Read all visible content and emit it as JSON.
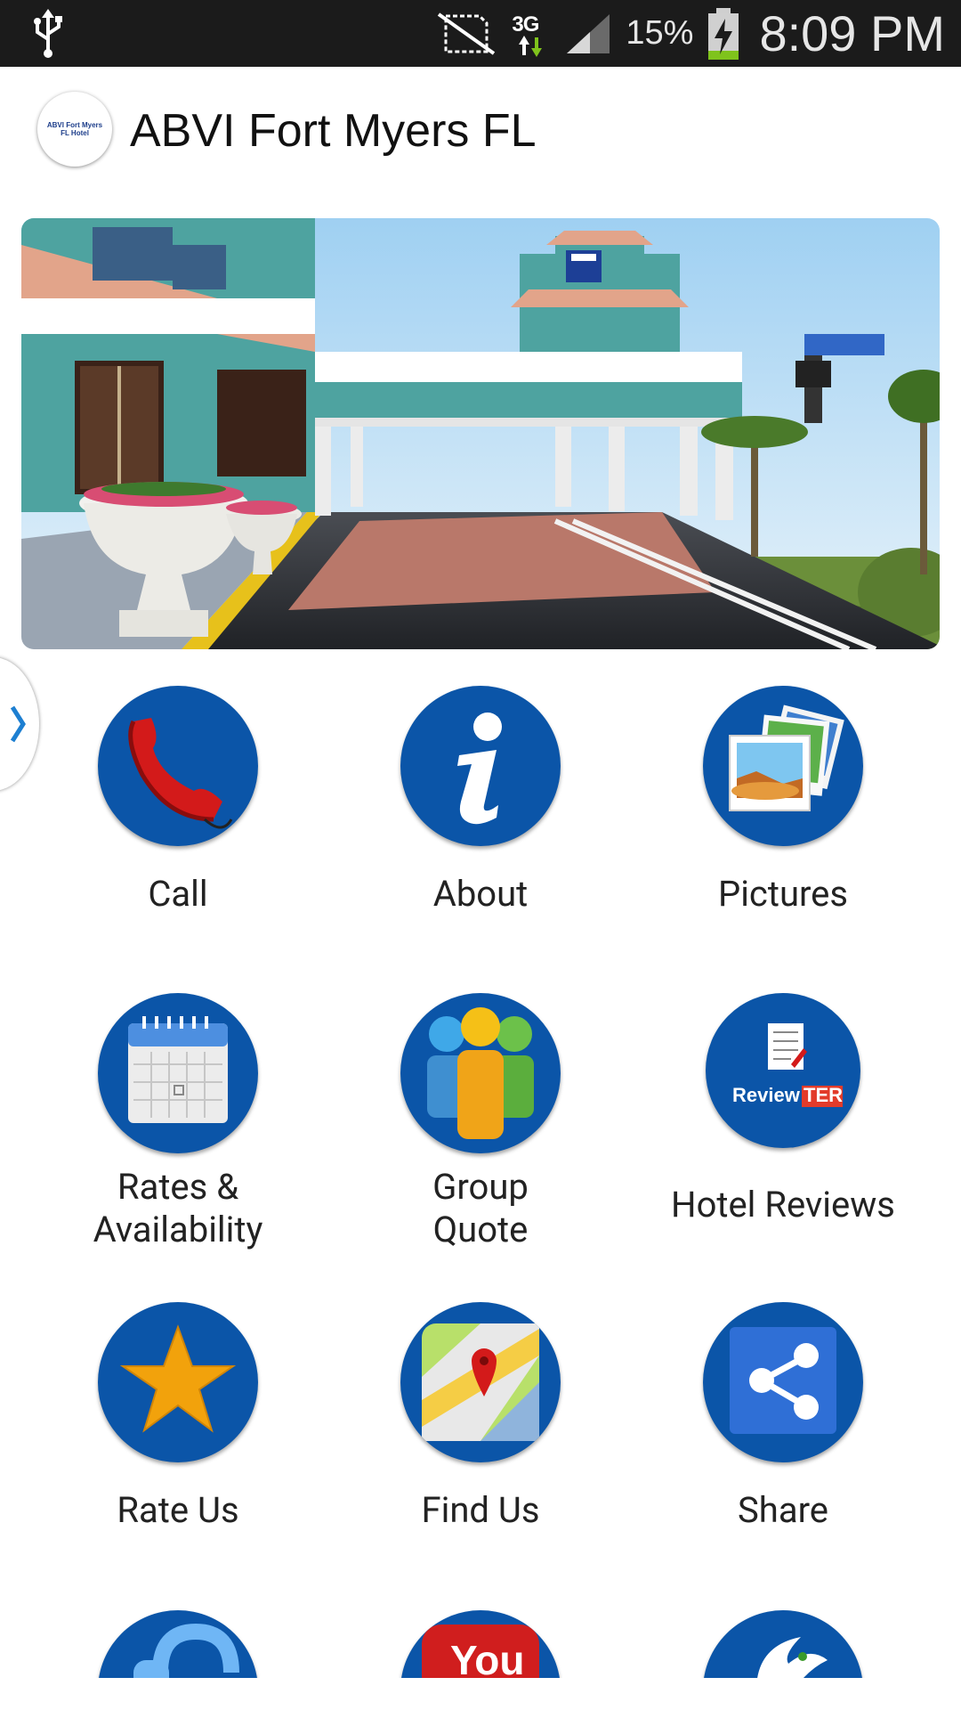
{
  "status_bar": {
    "network": "3G",
    "battery_percent": "15%",
    "time": "8:09 PM"
  },
  "header": {
    "logo_text": "ABVI Fort Myers FL Hotel",
    "title": "ABVI Fort Myers FL"
  },
  "grid": [
    {
      "label": "Call",
      "icon": "phone-icon"
    },
    {
      "label": "About",
      "icon": "info-icon"
    },
    {
      "label": "Pictures",
      "icon": "photos-icon"
    },
    {
      "label_line1": "Rates &",
      "label_line2": "Availability",
      "icon": "calendar-icon"
    },
    {
      "label_line1": "Group",
      "label_line2": "Quote",
      "icon": "group-icon"
    },
    {
      "label": "Hotel Reviews",
      "icon": "reviewter-icon",
      "icon_text": "ReviewTER"
    },
    {
      "label": "Rate Us",
      "icon": "star-icon"
    },
    {
      "label": "Find Us",
      "icon": "map-pin-icon"
    },
    {
      "label": "Share",
      "icon": "share-icon"
    },
    {
      "icon": "headset-icon"
    },
    {
      "icon": "youtube-icon",
      "icon_text": "You"
    },
    {
      "icon": "bird-icon"
    }
  ],
  "colors": {
    "icon_blue": "#0b55a8",
    "status_bar": "#1b1b1b"
  }
}
